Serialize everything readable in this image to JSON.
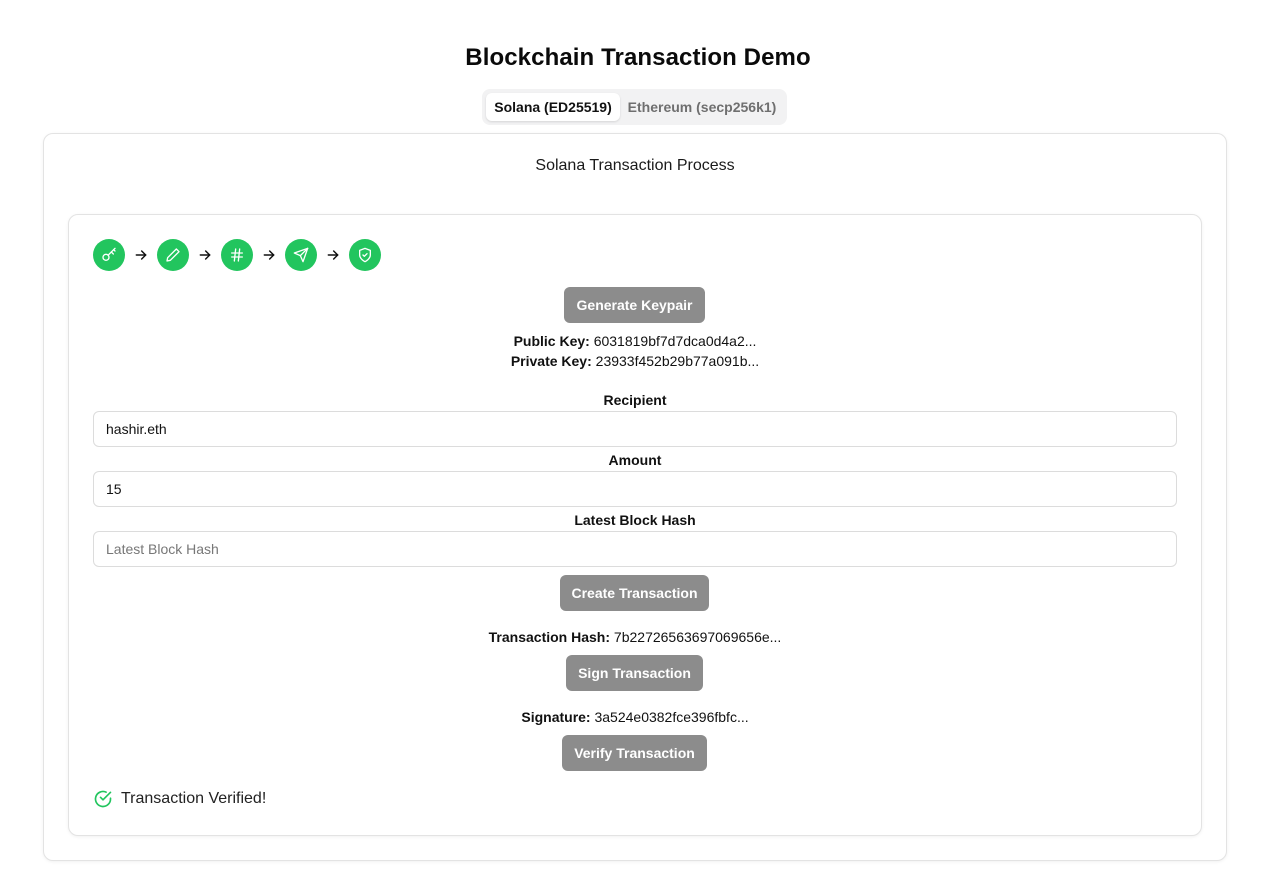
{
  "page": {
    "title": "Blockchain Transaction Demo"
  },
  "tabs": [
    {
      "label": "Solana (ED25519)",
      "active": true
    },
    {
      "label": "Ethereum (secp256k1)",
      "active": false
    }
  ],
  "card": {
    "title": "Solana Transaction Process"
  },
  "steps": [
    {
      "icon": "key-icon"
    },
    {
      "icon": "pencil-icon"
    },
    {
      "icon": "hash-icon"
    },
    {
      "icon": "send-icon"
    },
    {
      "icon": "shield-check-icon"
    }
  ],
  "colors": {
    "accent": "#22c55e",
    "button": "#8c8c8c"
  },
  "keypair": {
    "button_label": "Generate Keypair",
    "public_key_label": "Public Key:",
    "public_key_value": "6031819bf7d7dca0d4a2...",
    "private_key_label": "Private Key:",
    "private_key_value": "23933f452b29b77a091b..."
  },
  "form": {
    "recipient_label": "Recipient",
    "recipient_value": "hashir.eth",
    "amount_label": "Amount",
    "amount_value": "15",
    "block_hash_label": "Latest Block Hash",
    "block_hash_value": "",
    "block_hash_placeholder": "Latest Block Hash"
  },
  "transaction": {
    "create_button": "Create Transaction",
    "hash_label": "Transaction Hash:",
    "hash_value": "7b22726563697069656e...",
    "sign_button": "Sign Transaction",
    "signature_label": "Signature:",
    "signature_value": "3a524e0382fce396fbfc...",
    "verify_button": "Verify Transaction"
  },
  "status": {
    "message": "Transaction Verified!"
  }
}
